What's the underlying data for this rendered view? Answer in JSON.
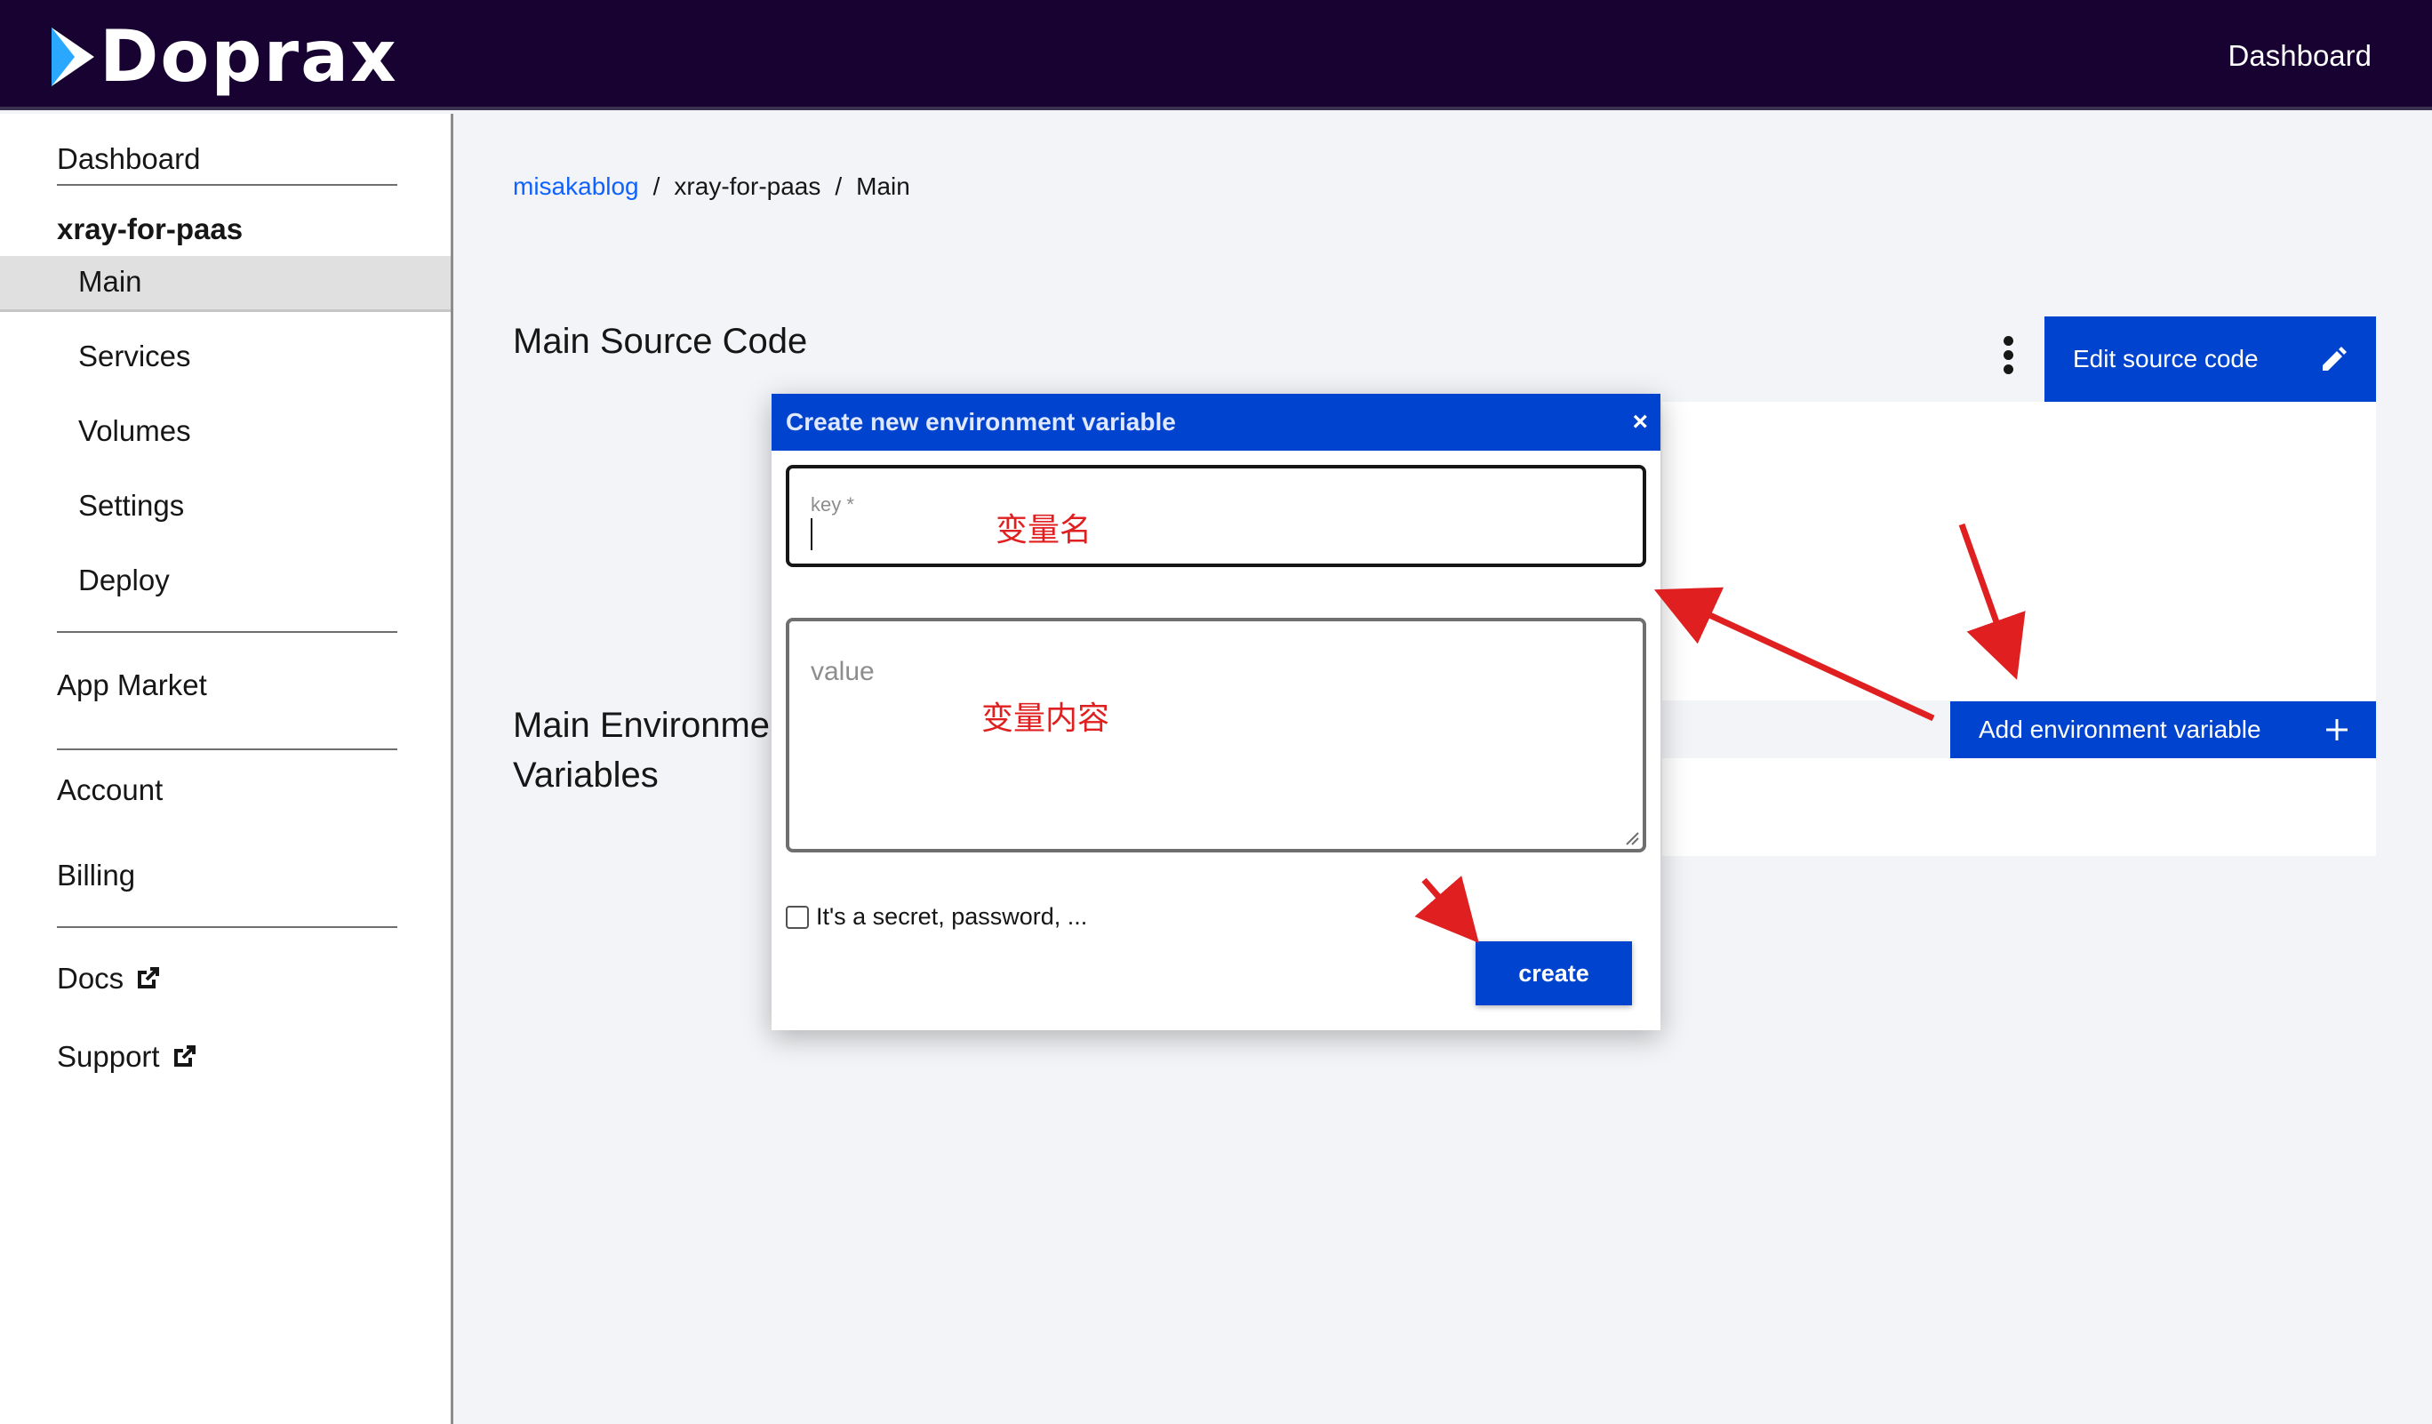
{
  "topbar": {
    "logo_text": "Doprax",
    "nav_dashboard": "Dashboard"
  },
  "sidebar": {
    "dashboard": "Dashboard",
    "project_name": "xray-for-paas",
    "items": [
      {
        "label": "Main",
        "active": true
      },
      {
        "label": "Services"
      },
      {
        "label": "Volumes"
      },
      {
        "label": "Settings"
      },
      {
        "label": "Deploy"
      }
    ],
    "app_market": "App Market",
    "account": "Account",
    "billing": "Billing",
    "docs": "Docs",
    "support": "Support"
  },
  "breadcrumb": {
    "user": "misakablog",
    "project": "xray-for-paas",
    "page": "Main",
    "separator": "/"
  },
  "source_section": {
    "title": "Main Source Code",
    "edit_button": "Edit source code"
  },
  "env_section": {
    "title_line1": "Main Environment",
    "title_line2": "Variables",
    "add_button": "Add environment variable"
  },
  "modal": {
    "title": "Create new environment variable",
    "close": "×",
    "key_label": "key *",
    "value_placeholder": "value",
    "secret_label": "It's a secret, password, ...",
    "secret_checked": false,
    "create_button": "create"
  },
  "annotations": {
    "key_note": "变量名",
    "value_note": "变量内容",
    "color": "#e02020"
  },
  "colors": {
    "topbar": "#170231",
    "primary": "#0043ce",
    "link": "#0f62fe"
  }
}
